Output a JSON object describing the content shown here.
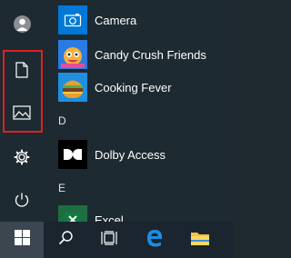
{
  "rail": {
    "items": [
      {
        "name": "account",
        "icon": "user-icon"
      },
      {
        "name": "documents",
        "icon": "document-icon"
      },
      {
        "name": "pictures",
        "icon": "pictures-icon"
      },
      {
        "name": "settings",
        "icon": "gear-icon"
      },
      {
        "name": "power",
        "icon": "power-icon"
      }
    ],
    "highlight_color": "#e02020"
  },
  "apps": {
    "headers": [
      "D",
      "E"
    ],
    "items": [
      {
        "label": "Camera",
        "icon": "camera-icon",
        "tile_color": "#0078d7"
      },
      {
        "label": "Candy Crush Friends",
        "icon": "candy-crush-icon",
        "tile_color": "#1e5fc9"
      },
      {
        "label": "Cooking Fever",
        "icon": "cooking-fever-icon",
        "tile_color": "#1a7fd4"
      },
      {
        "label": "Dolby Access",
        "icon": "dolby-icon",
        "tile_color": "#000000"
      },
      {
        "label": "Excel",
        "icon": "excel-icon",
        "tile_color": "#1d6f42"
      }
    ]
  },
  "taskbar": {
    "items": [
      {
        "name": "start",
        "icon": "windows-icon"
      },
      {
        "name": "search",
        "icon": "search-icon"
      },
      {
        "name": "task-view",
        "icon": "task-view-icon"
      },
      {
        "name": "edge",
        "icon": "edge-icon"
      },
      {
        "name": "file-explorer",
        "icon": "folder-icon"
      }
    ]
  }
}
